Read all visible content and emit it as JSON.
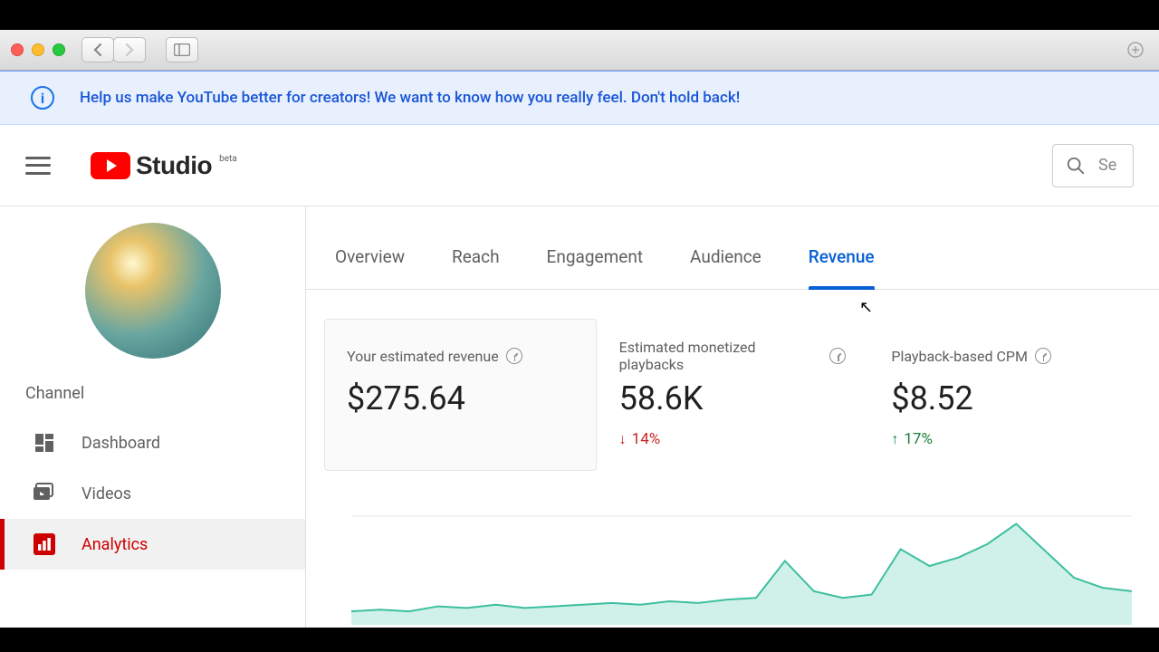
{
  "banner": {
    "text": "Help us make YouTube better for creators! We want to know how you really feel. Don't hold back!"
  },
  "logo": {
    "brand": "Studio",
    "tag": "beta"
  },
  "search": {
    "placeholder": "Se"
  },
  "sidebar": {
    "heading": "Channel",
    "items": [
      {
        "label": "Dashboard"
      },
      {
        "label": "Videos"
      },
      {
        "label": "Analytics"
      }
    ]
  },
  "tabs": [
    {
      "label": "Overview"
    },
    {
      "label": "Reach"
    },
    {
      "label": "Engagement"
    },
    {
      "label": "Audience"
    },
    {
      "label": "Revenue"
    }
  ],
  "metrics": {
    "revenue": {
      "title": "Your estimated revenue",
      "value": "$275.64"
    },
    "playbacks": {
      "title": "Estimated monetized playbacks",
      "value": "58.6K",
      "delta": "14%",
      "dir": "down"
    },
    "cpm": {
      "title": "Playback-based CPM",
      "value": "$8.52",
      "delta": "17%",
      "dir": "up"
    }
  },
  "chart_data": {
    "type": "area",
    "title": "",
    "xlabel": "",
    "ylabel": "",
    "x": [
      0,
      1,
      2,
      3,
      4,
      5,
      6,
      7,
      8,
      9,
      10,
      11,
      12,
      13,
      14,
      15,
      16,
      17,
      18,
      19,
      20,
      21,
      22,
      23,
      24,
      25,
      26,
      27
    ],
    "values": [
      8,
      9,
      8,
      11,
      10,
      12,
      10,
      11,
      12,
      13,
      12,
      14,
      13,
      15,
      16,
      38,
      20,
      16,
      18,
      45,
      35,
      40,
      48,
      60,
      44,
      28,
      22,
      20
    ],
    "ylim": [
      0,
      70
    ]
  }
}
